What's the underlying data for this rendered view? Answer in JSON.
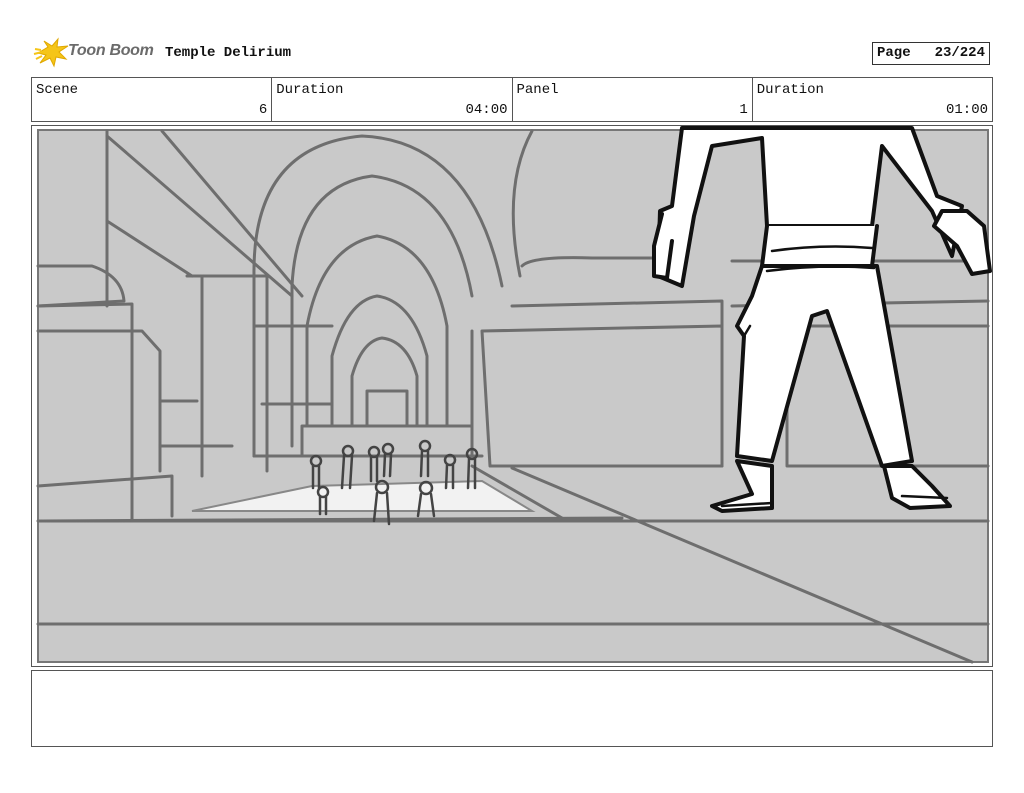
{
  "header": {
    "logo_text": "Toon Boom",
    "project_title": "Temple Delirium",
    "page_label": "Page",
    "page_value": "23/224"
  },
  "info": {
    "scene_label": "Scene",
    "scene_value": "6",
    "scene_duration_label": "Duration",
    "scene_duration_value": "04:00",
    "panel_label": "Panel",
    "panel_value": "1",
    "panel_duration_label": "Duration",
    "panel_duration_value": "01:00"
  },
  "notes": {
    "text": ""
  },
  "colors": {
    "logo_yellow": "#f5c518",
    "sketch_bg": "#c9c9c9",
    "sketch_line": "#6e6e6e",
    "character_line": "#111111"
  }
}
